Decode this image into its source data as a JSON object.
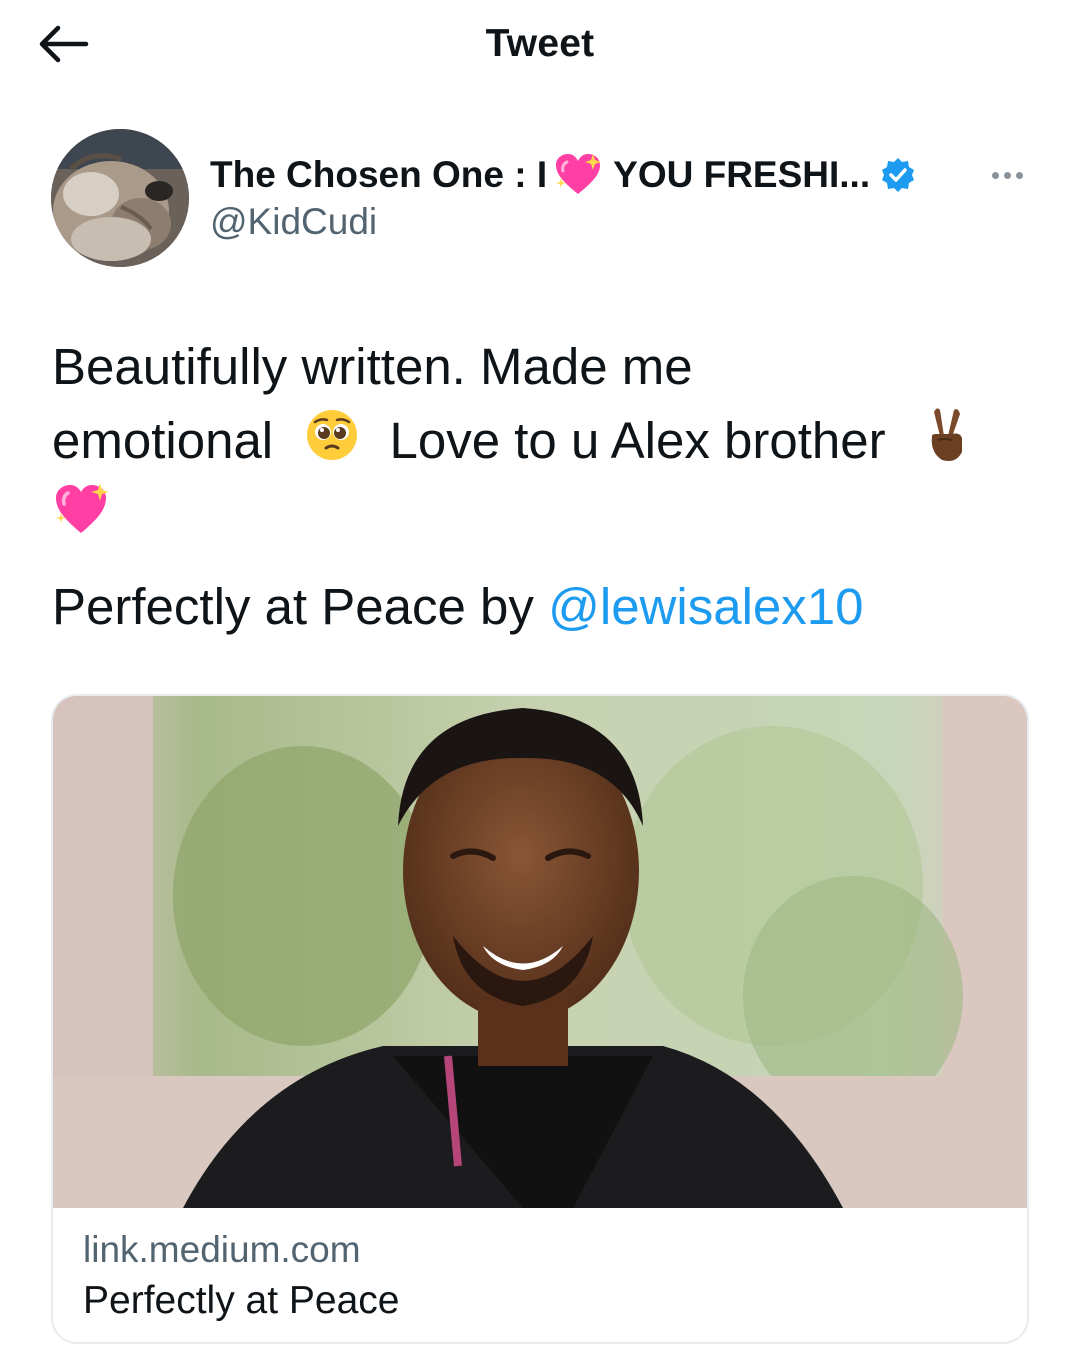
{
  "header": {
    "title": "Tweet",
    "back_icon": "arrow-left-icon"
  },
  "author": {
    "display_name_part1": "The Chosen One : I",
    "display_name_part2": "YOU FRESHI...",
    "name_emoji": "sparkling-heart-icon",
    "verified_icon": "verified-badge-icon",
    "handle": "@KidCudi",
    "more_icon": "more-dots-icon"
  },
  "tweet": {
    "line1": "Beautifully written.  Made me",
    "line2_a": "emotional",
    "line2_b": "Love to u Alex brother",
    "emojis": [
      "pleading-face-icon",
      "victory-hand-icon",
      "sparkling-heart-icon"
    ],
    "line4_text": "Perfectly at Peace by ",
    "mention": "@lewisalex10"
  },
  "card": {
    "domain": "link.medium.com",
    "title": "Perfectly at Peace"
  },
  "colors": {
    "link": "#1d9bf0",
    "secondary_text": "#536471",
    "verified": "#1d9bf0",
    "heart": "#ff3fa4"
  }
}
